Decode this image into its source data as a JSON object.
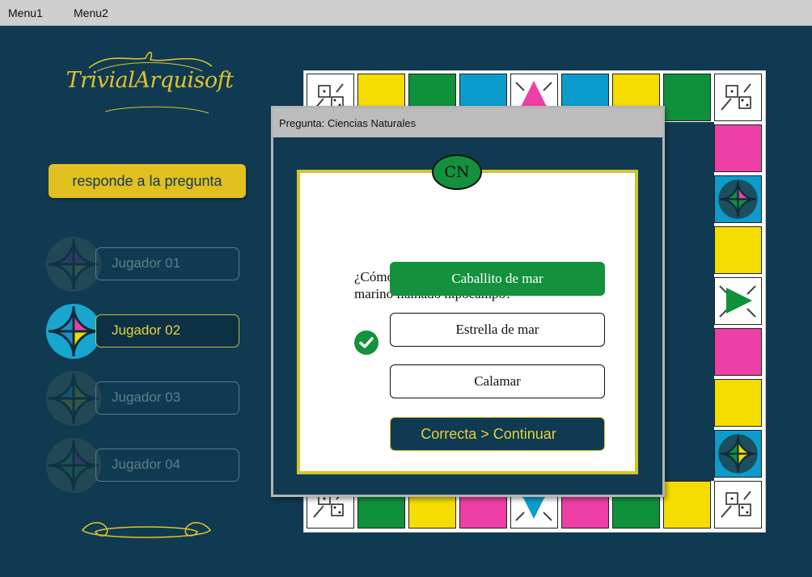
{
  "menu": {
    "items": [
      "Menu1",
      "Menu2"
    ]
  },
  "logo": {
    "text": "TrivialArquisoft"
  },
  "status": {
    "label": "responde a la pregunta"
  },
  "players": [
    {
      "name": "Jugador 01",
      "active": false,
      "colors": [
        "#5b3a7a",
        "#5b3a7a",
        "#2f6e55",
        "#5f7a2e"
      ]
    },
    {
      "name": "Jugador 02",
      "active": true,
      "colors": [
        "#1e8fbf",
        "#ee3f9f",
        "#1e8fbf",
        "#f0d800"
      ]
    },
    {
      "name": "Jugador 03",
      "active": false,
      "colors": [
        "#1e6f8f",
        "#5f7a2e",
        "#5f7a2e",
        "#5f7a2e"
      ]
    },
    {
      "name": "Jugador 04",
      "active": false,
      "colors": [
        "#2f6e55",
        "#5b3a7a",
        "#2f6e55",
        "#2f6e55"
      ]
    }
  ],
  "palette": {
    "background": "#0f3a52",
    "yellow": "#f5dd00",
    "green": "#0f913c",
    "blue": "#0b9ccc",
    "pink": "#ee3fa6",
    "accent": "#e2c01f"
  },
  "board": {
    "top": [
      "dice",
      "yellow",
      "green",
      "blue",
      "special-pink",
      "blue",
      "yellow",
      "green",
      "dice"
    ],
    "right": [
      "pink",
      "wedge-pink",
      "yellow",
      "special-green",
      "pink",
      "yellow",
      "wedge-yellow"
    ],
    "bottom": [
      "dice",
      "green",
      "yellow",
      "pink",
      "special-blue",
      "pink",
      "green",
      "yellow",
      "dice"
    ],
    "left": [
      "special",
      "yellow",
      "yellow",
      "special",
      "pink",
      "green",
      "yellow"
    ]
  },
  "dialog": {
    "title": "Pregunta: Ciencias Naturales",
    "category": "CN",
    "question": "¿Cómo es conocido popularmente el animal marino llamado hipocampo?",
    "answers": [
      {
        "label": "Caballito de mar",
        "correct": true
      },
      {
        "label": "Estrella de mar",
        "correct": false
      },
      {
        "label": "Calamar",
        "correct": false
      }
    ],
    "continue_label": "Correcta > Continuar"
  }
}
